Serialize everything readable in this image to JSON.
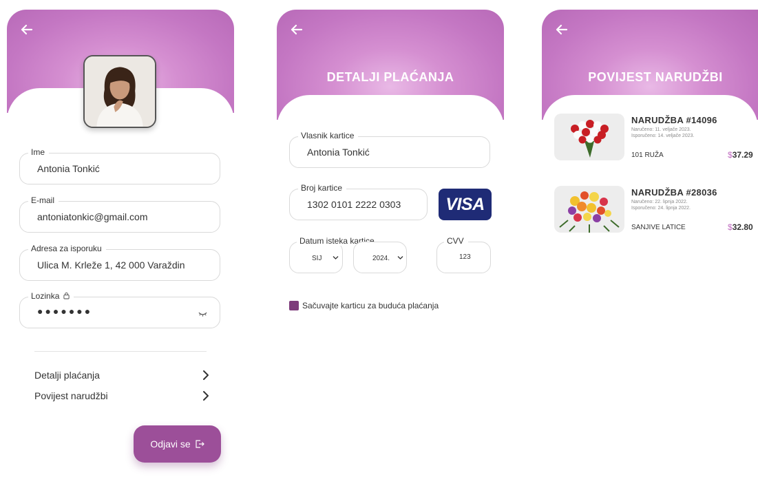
{
  "colors": {
    "header_gradient": "#c477c3",
    "accent": "#9c4f99",
    "visa_bg": "#1f2b76",
    "price_currency": "#c06cc0"
  },
  "profile": {
    "back_icon": "arrow-left-icon",
    "avatar_icon": "user-avatar",
    "fields": {
      "name": {
        "label": "Ime",
        "value": "Antonia Tonkić"
      },
      "email": {
        "label": "E-mail",
        "value": "antoniatonkic@gmail.com"
      },
      "address": {
        "label": "Adresa za isporuku",
        "value": "Ulica M. Krleže 1, 42 000 Varaždin"
      },
      "password": {
        "label": "Lozinka",
        "value": "●●●●●●●",
        "lock_icon": "lock-icon",
        "toggle_icon": "eye-closed-icon"
      }
    },
    "menu": [
      {
        "label": "Detalji plaćanja",
        "icon": "chevron-right-icon"
      },
      {
        "label": "Povijest narudžbi",
        "icon": "chevron-right-icon"
      }
    ],
    "logout_label": "Odjavi se",
    "logout_icon": "logout-icon"
  },
  "payment": {
    "title": "DETALJI PLAĆANJA",
    "card_holder": {
      "label": "Vlasnik kartice",
      "value": "Antonia Tonkić"
    },
    "card_number": {
      "label": "Broj kartice",
      "value": "1302 0101 2222 0303"
    },
    "card_brand": "VISA",
    "expiry": {
      "label": "Datum isteka kartice",
      "month": "SIJ",
      "year": "2024."
    },
    "cvv": {
      "label": "CVV",
      "value": "123"
    },
    "save_card_label": "Sačuvajte karticu za buduća plaćanja",
    "save_card_checked": true
  },
  "orders": {
    "title": "POVIJEST NARUDŽBI",
    "items": [
      {
        "title": "NARUDŽBA #14096",
        "ordered": "Naručeno: 11. veljače 2023.",
        "delivered": "Isporučeno: 14. veljače 2023.",
        "product": "101 RUŽA",
        "currency": "$",
        "amount": "37.29"
      },
      {
        "title": "NARUDŽBA #28036",
        "ordered": "Naručeno: 22. lipnja 2022.",
        "delivered": "Isporučeno: 24. lipnja 2022.",
        "product": "SANJIVE LATICE",
        "currency": "$",
        "amount": "32.80"
      }
    ]
  }
}
